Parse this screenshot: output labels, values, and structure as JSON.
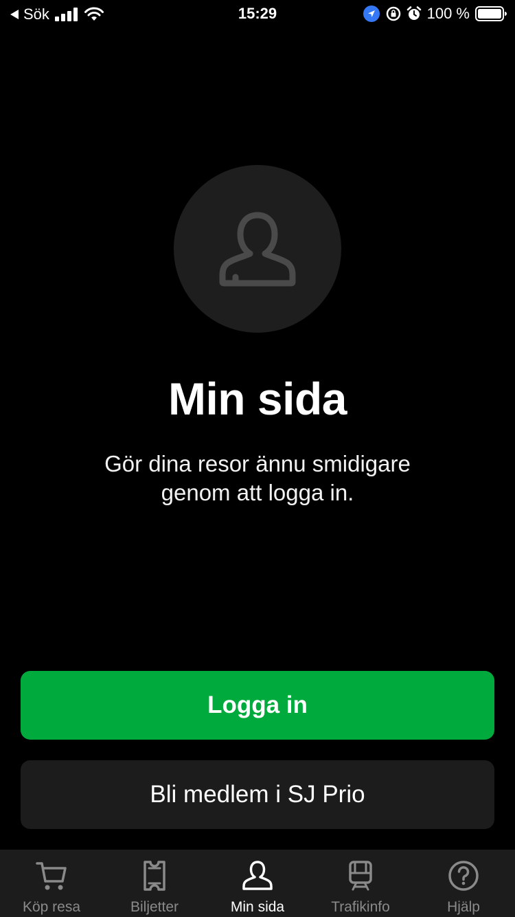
{
  "status_bar": {
    "back_label": "Sök",
    "time": "15:29",
    "battery": "100 %"
  },
  "main": {
    "title": "Min sida",
    "subtitle": "Gör dina resor ännu smidigare genom att logga in."
  },
  "buttons": {
    "login": "Logga in",
    "join": "Bli medlem i SJ Prio"
  },
  "tabs": [
    {
      "label": "Köp resa",
      "icon": "cart-icon",
      "active": false
    },
    {
      "label": "Biljetter",
      "icon": "ticket-icon",
      "active": false
    },
    {
      "label": "Min sida",
      "icon": "person-icon",
      "active": true
    },
    {
      "label": "Trafikinfo",
      "icon": "train-icon",
      "active": false
    },
    {
      "label": "Hjälp",
      "icon": "help-icon",
      "active": false
    }
  ],
  "colors": {
    "background": "#000000",
    "primary_button": "#00aa3d",
    "secondary_button": "#1c1c1c",
    "tab_bar": "#1c1c1c",
    "inactive_tab": "#8a8a8a",
    "location_icon": "#3478f6"
  }
}
